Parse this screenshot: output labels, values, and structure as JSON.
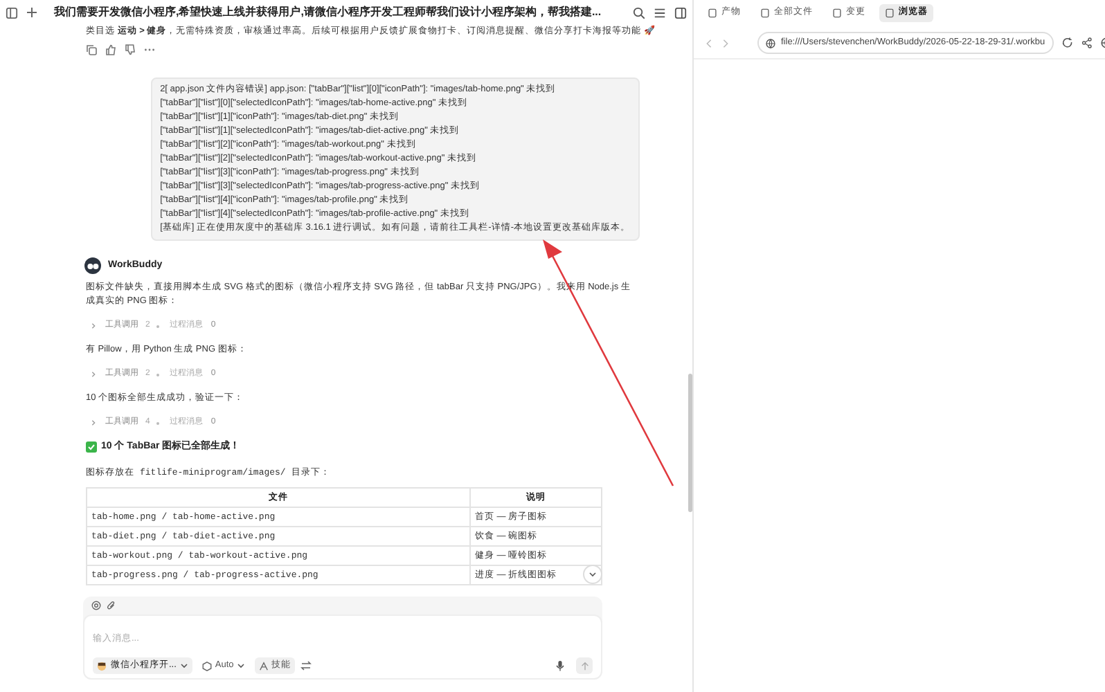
{
  "header": {
    "title": "我们需要开发微信小程序,希望快速上线并获得用户,请微信小程序开发工程师帮我们设计小程序架构，帮我搭建..."
  },
  "previous_message": {
    "text": "类目选 **运动 > 健身**，无需特殊资质，审核通过率高。后续可根据用户反馈扩展食物打卡、订阅消息提醒、微信分享打卡海报等功能 🚀"
  },
  "user_message": {
    "lines": [
      "2[ app.json 文件内容错误] app.json: [\"tabBar\"][\"list\"][0][\"iconPath\"]: \"images/tab-home.png\" 未找到",
      "[\"tabBar\"][\"list\"][0][\"selectedIconPath\"]: \"images/tab-home-active.png\" 未找到",
      "[\"tabBar\"][\"list\"][1][\"iconPath\"]: \"images/tab-diet.png\" 未找到",
      "[\"tabBar\"][\"list\"][1][\"selectedIconPath\"]: \"images/tab-diet-active.png\" 未找到",
      "[\"tabBar\"][\"list\"][2][\"iconPath\"]: \"images/tab-workout.png\" 未找到",
      "[\"tabBar\"][\"list\"][2][\"selectedIconPath\"]: \"images/tab-workout-active.png\" 未找到",
      "[\"tabBar\"][\"list\"][3][\"iconPath\"]: \"images/tab-progress.png\" 未找到",
      "[\"tabBar\"][\"list\"][3][\"selectedIconPath\"]: \"images/tab-progress-active.png\" 未找到",
      "[\"tabBar\"][\"list\"][4][\"iconPath\"]: \"images/tab-profile.png\" 未找到",
      "[\"tabBar\"][\"list\"][4][\"selectedIconPath\"]: \"images/tab-profile-active.png\" 未找到",
      "[基础库] 正在使用灰度中的基础库 3.16.1 进行调试。如有问题，请前往工具栏-详情-本地设置更改基础库版本。"
    ]
  },
  "assistant": {
    "name": "WorkBuddy",
    "blocks": [
      {
        "kind": "text",
        "text": "图标文件缺失，直接用脚本生成 SVG 格式的图标（微信小程序支持 SVG 路径，但 tabBar 只支持 PNG/JPG）。我来用 Node.js 生成真实的 PNG 图标："
      },
      {
        "kind": "tool",
        "tool_label": "工具调用",
        "tool_count": "2",
        "process_label": "过程消息",
        "process_count": "0"
      },
      {
        "kind": "text",
        "text": "有 Pillow，用 Python 生成 PNG 图标："
      },
      {
        "kind": "tool",
        "tool_label": "工具调用",
        "tool_count": "2",
        "process_label": "过程消息",
        "process_count": "0"
      },
      {
        "kind": "text",
        "text": "10 个图标全部生成成功，验证一下："
      },
      {
        "kind": "tool",
        "tool_label": "工具调用",
        "tool_count": "4",
        "process_label": "过程消息",
        "process_count": "0"
      },
      {
        "kind": "heading",
        "text": "10 个 TabBar 图标已全部生成！"
      },
      {
        "kind": "code_text",
        "before": "图标存放在",
        "code": "fitlife-miniprogram/images/",
        "after": "目录下："
      }
    ],
    "table": {
      "columns": [
        "文件",
        "说明"
      ],
      "rows": [
        [
          "tab-home.png / tab-home-active.png",
          "首页 — 房子图标"
        ],
        [
          "tab-diet.png / tab-diet-active.png",
          "饮食 — 碗图标"
        ],
        [
          "tab-workout.png / tab-workout-active.png",
          "健身 — 哑铃图标"
        ],
        [
          "tab-progress.png / tab-progress-active.png",
          "进度 — 折线图图标"
        ]
      ]
    }
  },
  "composer": {
    "placeholder": "输入消息...",
    "agent": "微信小程序开...",
    "model": "Auto",
    "skill": "技能"
  },
  "browser": {
    "tabs": [
      {
        "label": "产物",
        "selected": false
      },
      {
        "label": "全部文件",
        "selected": false
      },
      {
        "label": "变更",
        "selected": false
      },
      {
        "label": "浏览器",
        "selected": true
      }
    ],
    "url": "file:///Users/stevenchen/WorkBuddy/2026-05-22-18-29-31/.workbu"
  }
}
